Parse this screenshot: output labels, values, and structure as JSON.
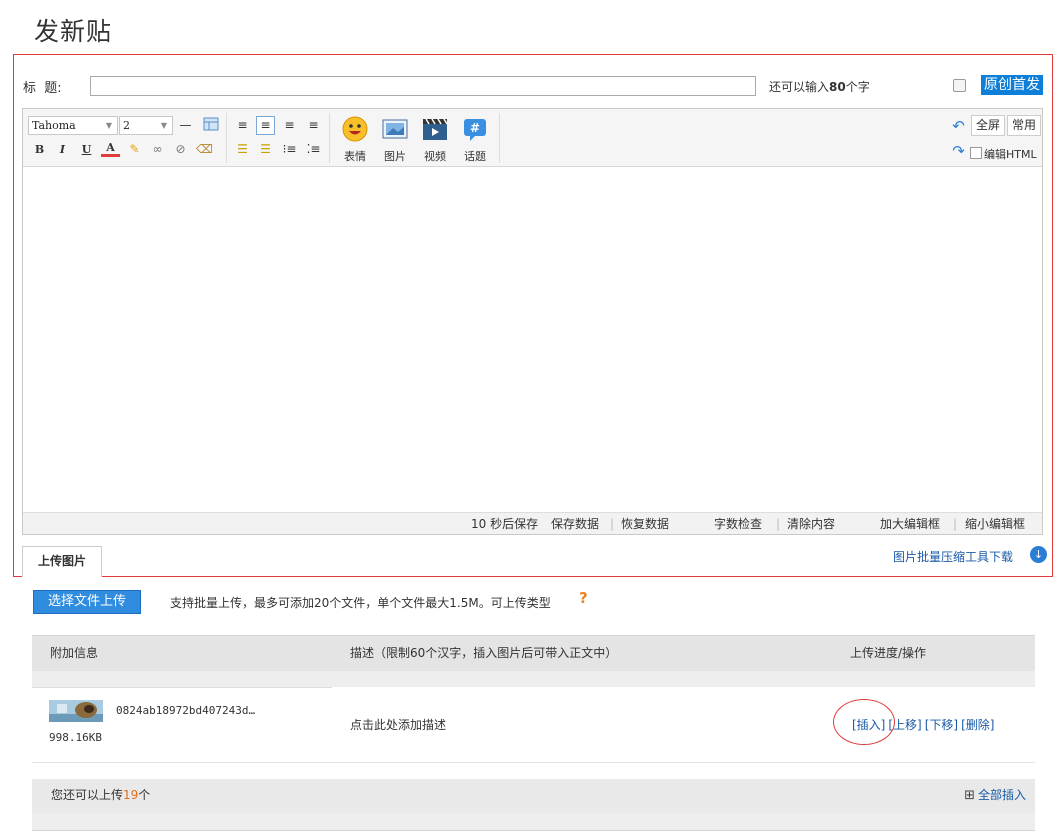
{
  "page": {
    "title": "发新贴"
  },
  "title_row": {
    "label": "标  题:",
    "remaining_prefix": "还可以输入",
    "remaining_count": "80",
    "remaining_suffix": "个字",
    "original_label": "原创首发"
  },
  "toolbar": {
    "font_family": "Tahoma",
    "font_size": "2",
    "align_buttons": [
      "align-left",
      "align-justify",
      "align-center",
      "align-right"
    ],
    "insert_labels": [
      "表情",
      "图片",
      "视频",
      "话题"
    ],
    "fullscreen_label": "全屏",
    "common_label": "常用",
    "edit_html_label": "编辑HTML"
  },
  "statusbar": {
    "autosave": "10 秒后保存",
    "save": "保存数据",
    "restore": "恢复数据",
    "word_check": "字数检查",
    "clear": "清除内容",
    "enlarge": "加大编辑框",
    "shrink": "缩小编辑框"
  },
  "upload": {
    "tab_label": "上传图片",
    "batch_tool_link": "图片批量压缩工具下载",
    "choose_button": "选择文件上传",
    "tip": "支持批量上传，最多可添加20个文件，单个文件最大1.5M。可上传类型"
  },
  "table": {
    "headers": [
      "附加信息",
      "描述（限制60个汉字，插入图片后可带入正文中）",
      "上传进度/操作"
    ],
    "rows": [
      {
        "filename": "0824ab18972bd407243d…",
        "size": "998.16KB",
        "description_hint": "点击此处添加描述",
        "ops": [
          "[插入]",
          "[上移]",
          "[下移]",
          "[删除]"
        ]
      }
    ],
    "remaining_prefix": "您还可以上传",
    "remaining_count": "19",
    "remaining_suffix": "个",
    "insert_all": "全部插入"
  },
  "colors": {
    "frame_border": "#e03a3a",
    "accent_blue": "#0e7fd8",
    "link_blue": "#1a5aa8",
    "count_orange": "#e0701b"
  }
}
